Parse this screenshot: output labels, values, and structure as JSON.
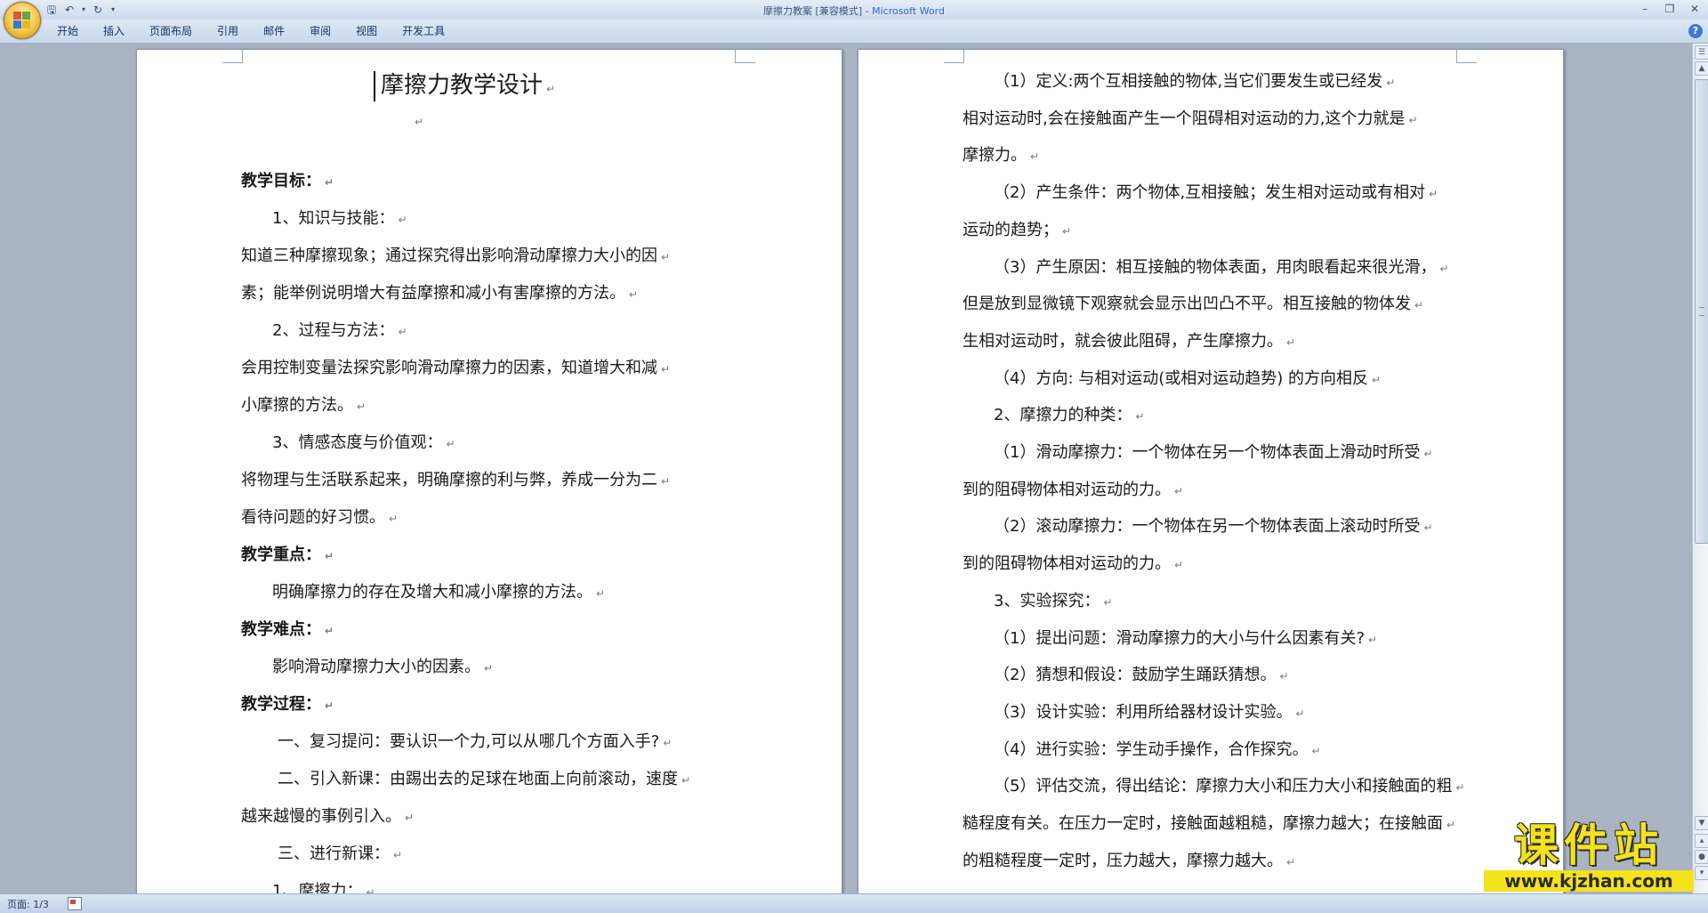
{
  "window": {
    "title_doc": "摩擦力教案 [兼容模式] - ",
    "title_app": "Microsoft Word"
  },
  "ribbon": {
    "tabs": [
      "开始",
      "插入",
      "页面布局",
      "引用",
      "邮件",
      "审阅",
      "视图",
      "开发工具"
    ]
  },
  "page1": {
    "title": "摩擦力教学设计",
    "lines": [
      "教学目标：",
      "1、知识与技能：",
      "知道三种摩擦现象；通过探究得出影响滑动摩擦力大小的因",
      "素；能举例说明增大有益摩擦和减小有害摩擦的方法。",
      "2、过程与方法：",
      "会用控制变量法探究影响滑动摩擦力的因素，知道增大和减",
      "小摩擦的方法。",
      "3、情感态度与价值观：",
      "将物理与生活联系起来，明确摩擦的利与弊，养成一分为二",
      "看待问题的好习惯。",
      "教学重点：",
      "明确摩擦力的存在及增大和减小摩擦的方法。",
      "教学难点：",
      "影响滑动摩擦力大小的因素。",
      "教学过程：",
      "一、复习提问：要认识一个力,可以从哪几个方面入手?",
      "二、引入新课：由踢出去的足球在地面上向前滚动，速度",
      "越来越慢的事例引入。",
      "三、进行新课：",
      "1、摩擦力："
    ]
  },
  "page2": {
    "lines": [
      "（1）定义:两个互相接触的物体,当它们要发生或已经发",
      "相对运动时,会在接触面产生一个阻碍相对运动的力,这个力就是",
      "摩擦力。",
      "（2）产生条件：两个物体,互相接触；发生相对运动或有相对",
      "运动的趋势；",
      "（3）产生原因：相互接触的物体表面，用肉眼看起来很光滑，",
      "但是放到显微镜下观察就会显示出凹凸不平。相互接触的物体发",
      "生相对运动时，就会彼此阻碍，产生摩擦力。",
      "（4）方向: 与相对运动(或相对运动趋势) 的方向相反",
      "2、摩擦力的种类：",
      "（1）滑动摩擦力：一个物体在另一个物体表面上滑动时所受",
      "到的阻碍物体相对运动的力。",
      "（2）滚动摩擦力：一个物体在另一个物体表面上滚动时所受",
      "到的阻碍物体相对运动的力。",
      "3、实验探究：",
      "（1）提出问题：滑动摩擦力的大小与什么因素有关?",
      "（2）猜想和假设：鼓励学生踊跃猜想。",
      "（3）设计实验：利用所给器材设计实验。",
      "（4）进行实验：学生动手操作，合作探究。",
      "（5）评估交流，得出结论：摩擦力大小和压力大小和接触面的粗",
      "糙程度有关。在压力一定时，接触面越粗糙，摩擦力越大；在接触面",
      "的粗糙程度一定时，压力越大，摩擦力越大。"
    ]
  },
  "status": {
    "page": "页面: 1/3"
  },
  "watermark": {
    "title": "课件站",
    "url": "www.kjzhan.com"
  },
  "icons": {
    "save": "save-icon",
    "undo": "undo-icon",
    "redo": "redo-icon",
    "customize": "customize-qat-icon",
    "help": "help-icon"
  }
}
